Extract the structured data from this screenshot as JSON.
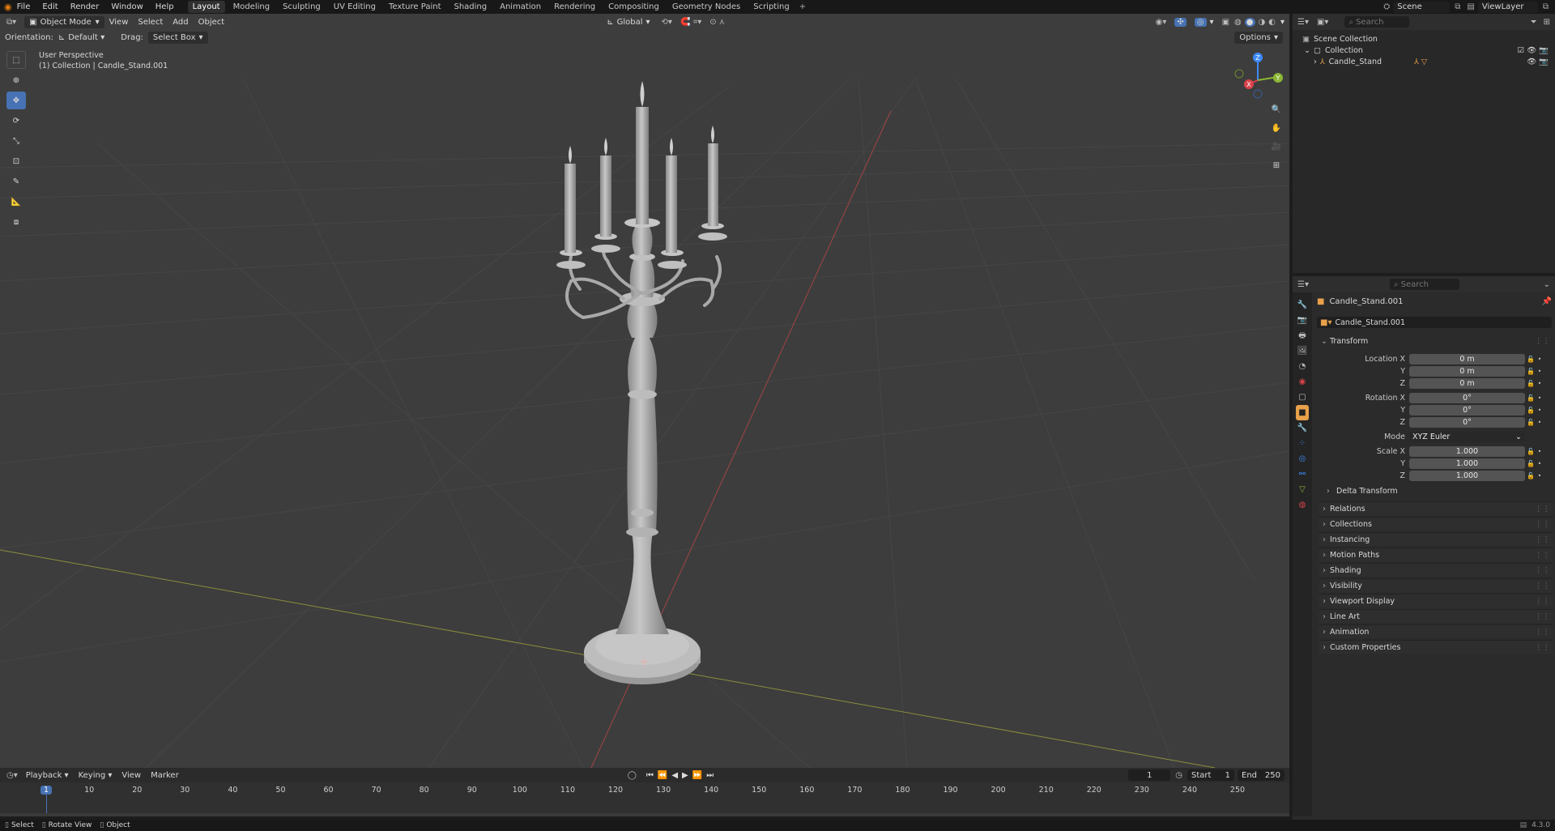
{
  "topbar": {
    "menus": [
      "File",
      "Edit",
      "Render",
      "Window",
      "Help"
    ],
    "workspaces": [
      "Layout",
      "Modeling",
      "Sculpting",
      "UV Editing",
      "Texture Paint",
      "Shading",
      "Animation",
      "Rendering",
      "Compositing",
      "Geometry Nodes",
      "Scripting"
    ],
    "active_workspace": "Layout",
    "scene": "Scene",
    "view_layer": "ViewLayer"
  },
  "viewport": {
    "mode": "Object Mode",
    "menus": [
      "View",
      "Select",
      "Add",
      "Object"
    ],
    "transform_orientation": "Global",
    "orientation_label": "Orientation:",
    "orientation_value": "Default",
    "drag_label": "Drag:",
    "drag_value": "Select Box",
    "options_label": "Options",
    "perspective": "User Perspective",
    "collection_info": "(1) Collection | Candle_Stand.001",
    "gizmo_axes": [
      "X",
      "Y",
      "Z"
    ]
  },
  "outliner": {
    "search_placeholder": "Search",
    "scene_collection": "Scene Collection",
    "collection": "Collection",
    "object": "Candle_Stand"
  },
  "properties": {
    "search_placeholder": "Search",
    "object_name": "Candle_Stand.001",
    "data_name": "Candle_Stand.001",
    "transform_title": "Transform",
    "location_label": "Location X",
    "location": [
      "0 m",
      "0 m",
      "0 m"
    ],
    "rotation_label": "Rotation X",
    "rotation": [
      "0°",
      "0°",
      "0°"
    ],
    "mode_label": "Mode",
    "mode_value": "XYZ Euler",
    "scale_label": "Scale X",
    "scale": [
      "1.000",
      "1.000",
      "1.000"
    ],
    "axis_y": "Y",
    "axis_z": "Z",
    "delta_transform": "Delta Transform",
    "panels": [
      "Relations",
      "Collections",
      "Instancing",
      "Motion Paths",
      "Shading",
      "Visibility",
      "Viewport Display",
      "Line Art",
      "Animation",
      "Custom Properties"
    ]
  },
  "timeline": {
    "menus": [
      "Playback",
      "Keying",
      "View",
      "Marker"
    ],
    "current_frame": "1",
    "start_label": "Start",
    "start": "1",
    "end_label": "End",
    "end": "250",
    "ticks": [
      "1",
      "10",
      "20",
      "30",
      "40",
      "50",
      "60",
      "70",
      "80",
      "90",
      "100",
      "110",
      "120",
      "130",
      "140",
      "150",
      "160",
      "170",
      "180",
      "190",
      "200",
      "210",
      "220",
      "230",
      "240",
      "250"
    ]
  },
  "statusbar": {
    "items": [
      "Select",
      "Rotate View",
      "Object"
    ],
    "version": "4.3.0"
  },
  "colors": {
    "accent": "#4772b3",
    "x_axis": "#d9434b",
    "y_axis": "#8bb635",
    "z_axis": "#3d8af7",
    "viewport_bg": "#3d3d3d"
  }
}
